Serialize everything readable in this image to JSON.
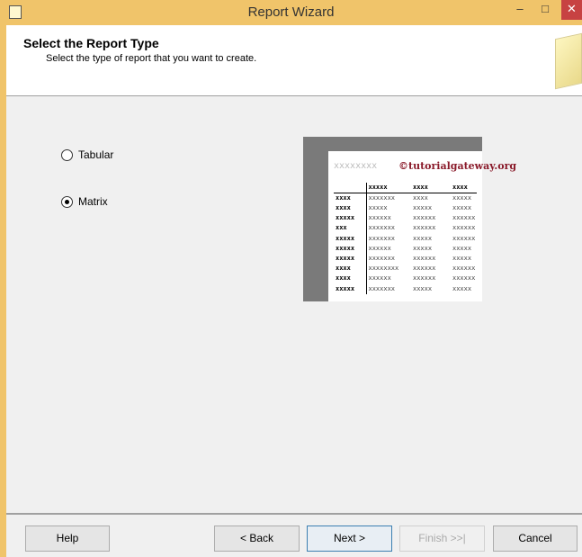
{
  "window": {
    "title": "Report Wizard",
    "minimize": "–",
    "maximize": "□",
    "close": "✕"
  },
  "header": {
    "title": "Select the Report Type",
    "subtitle": "Select the type of report that you want to create."
  },
  "options": [
    {
      "label": "Tabular",
      "selected": false
    },
    {
      "label": "Matrix",
      "selected": true
    }
  ],
  "preview": {
    "title": "xxxxxxxx",
    "watermark": "©tutorialgateway.org",
    "header": [
      "",
      "xxxxx",
      "xxxx",
      "xxxx"
    ],
    "rows": [
      [
        "xxxx",
        "xxxxxxx",
        "xxxx",
        "xxxxx"
      ],
      [
        "xxxx",
        "xxxxx",
        "xxxxx",
        "xxxxx"
      ],
      [
        "xxxxx",
        "xxxxxx",
        "xxxxxx",
        "xxxxxx"
      ],
      [
        "xxx",
        "xxxxxxx",
        "xxxxxx",
        "xxxxxx"
      ],
      [
        "xxxxx",
        "xxxxxxx",
        "xxxxx",
        "xxxxxx"
      ],
      [
        "xxxxx",
        "xxxxxx",
        "xxxxx",
        "xxxxx"
      ],
      [
        "xxxxx",
        "xxxxxxx",
        "xxxxxx",
        "xxxxx"
      ],
      [
        "xxxx",
        "xxxxxxxx",
        "xxxxxx",
        "xxxxxx"
      ],
      [
        "xxxx",
        "xxxxxx",
        "xxxxxx",
        "xxxxxx"
      ],
      [
        "xxxxx",
        "xxxxxxx",
        "xxxxx",
        "xxxxx"
      ]
    ]
  },
  "buttons": {
    "help": "Help",
    "back": "< Back",
    "next": "Next >",
    "finish": "Finish >>|",
    "cancel": "Cancel"
  }
}
